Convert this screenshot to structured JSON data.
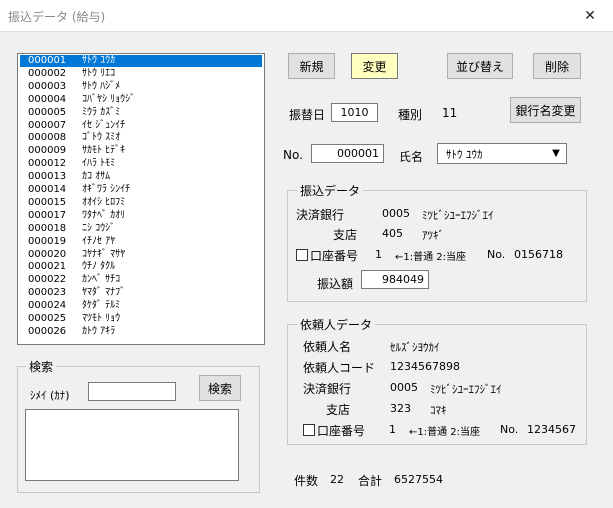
{
  "window": {
    "title": "振込データ (給与)",
    "close_glyph": "✕"
  },
  "list": {
    "items": [
      {
        "code": "000001",
        "name": "ｻﾄｳ ﾕｳｶ"
      },
      {
        "code": "000002",
        "name": "ｻﾄｳ ﾘｴｺ"
      },
      {
        "code": "000003",
        "name": "ｻﾄｳ ﾊｼﾞﾒ"
      },
      {
        "code": "000004",
        "name": "ｺﾊﾞﾔｼ ﾘｮｳｼﾞ"
      },
      {
        "code": "000005",
        "name": "ﾐｳﾗ ｶｽﾞﾐ"
      },
      {
        "code": "000007",
        "name": "ｲｾ ｼﾞｭﾝｲﾁ"
      },
      {
        "code": "000008",
        "name": "ｺﾞﾄｳ ｽﾐｵ"
      },
      {
        "code": "000009",
        "name": "ｻｶﾓﾄ ﾋﾃﾞｷ"
      },
      {
        "code": "000012",
        "name": "ｲﾊﾗ ﾄﾓﾐ"
      },
      {
        "code": "000013",
        "name": "ｶｺ ｵｻﾑ"
      },
      {
        "code": "000014",
        "name": "ｵｷﾞﾜﾗ ｼﾝｲﾁ"
      },
      {
        "code": "000015",
        "name": "ｵｵｲｼ ﾋﾛﾌﾐ"
      },
      {
        "code": "000017",
        "name": "ﾜﾀﾅﾍﾞ ｶｵﾘ"
      },
      {
        "code": "000018",
        "name": "ﾆｼ ｺｳｼﾞ"
      },
      {
        "code": "000019",
        "name": "ｲﾁﾉｾ ｱﾔ"
      },
      {
        "code": "000020",
        "name": "ｺﾔﾅｷﾞ ﾏｻﾔ"
      },
      {
        "code": "000021",
        "name": "ｳﾁﾉ ﾀｸﾙ"
      },
      {
        "code": "000022",
        "name": "ｶﾝﾍﾞ ｻﾁｺ"
      },
      {
        "code": "000023",
        "name": "ﾔﾏﾀﾞ ﾏﾅﾌﾞ"
      },
      {
        "code": "000024",
        "name": "ﾀｹﾀﾞ ﾃﾙﾐ"
      },
      {
        "code": "000025",
        "name": "ﾏﾂﾓﾄ ﾘｮｳ"
      },
      {
        "code": "000026",
        "name": "ｶﾄｳ ｱｷﾗ"
      }
    ]
  },
  "search": {
    "group": "検索",
    "label": "ｼﾒｲ (ｶﾅ)",
    "value": "",
    "button": "検索"
  },
  "toolbar": {
    "new": "新規",
    "change": "変更",
    "sort": "並び替え",
    "delete": "削除",
    "bank_rename": "銀行名変更"
  },
  "header": {
    "transfer_date_label": "振替日",
    "transfer_date": "1010",
    "type_label": "種別",
    "type_value": "11",
    "no_label": "No.",
    "no_value": "000001",
    "name_label": "氏名",
    "name_value": "ｻﾄｳ ﾕｳｶ"
  },
  "transfer": {
    "group": "振込データ",
    "bank_label": "決済銀行",
    "bank_code": "0005",
    "bank_name": "ﾐﾂﾋﾞｼﾕｰｴﾌｼﾞｴｲ",
    "branch_label": "支店",
    "branch_code": "405",
    "branch_name": "ｱﾂｷﾞ",
    "account_label": "口座番号",
    "account_type": "1",
    "account_hint": "←1:普通 2:当座",
    "account_no_label": "No.",
    "account_no": "0156718",
    "amount_label": "振込額",
    "amount": "984049"
  },
  "requester": {
    "group": "依頼人データ",
    "name_label": "依頼人名",
    "name": "ｾﾙｽﾞｼﾖｳｶｲ",
    "code_label": "依頼人コード",
    "code": "1234567898",
    "bank_label": "決済銀行",
    "bank_code": "0005",
    "bank_name": "ﾐﾂﾋﾞｼﾕｰｴﾌｼﾞｴｲ",
    "branch_label": "支店",
    "branch_code": "323",
    "branch_name": "ｺﾏｷ",
    "account_label": "口座番号",
    "account_type": "1",
    "account_hint": "←1:普通 2:当座",
    "account_no_label": "No.",
    "account_no": "1234567"
  },
  "summary": {
    "count_label": "件数",
    "count": "22",
    "total_label": "合計",
    "total": "6527554"
  }
}
